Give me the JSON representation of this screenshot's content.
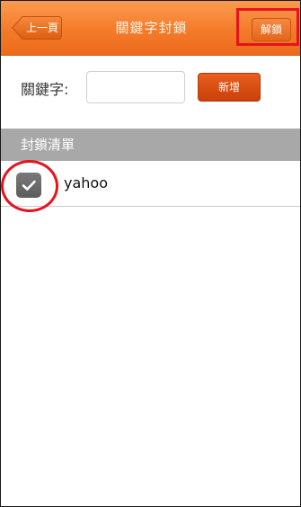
{
  "navbar": {
    "back_label": "上一頁",
    "title": "關鍵字封鎖",
    "unlock_label": "解鎖",
    "accent_color": "#f47b2a"
  },
  "keyword_form": {
    "label": "關鍵字:",
    "input_value": "",
    "add_label": "新增"
  },
  "block_list": {
    "header": "封鎖清單",
    "items": [
      {
        "label": "yahoo",
        "checked": true,
        "icon": "checkmark-icon"
      }
    ]
  },
  "annotations": {
    "highlight_color": "#e6121c"
  }
}
